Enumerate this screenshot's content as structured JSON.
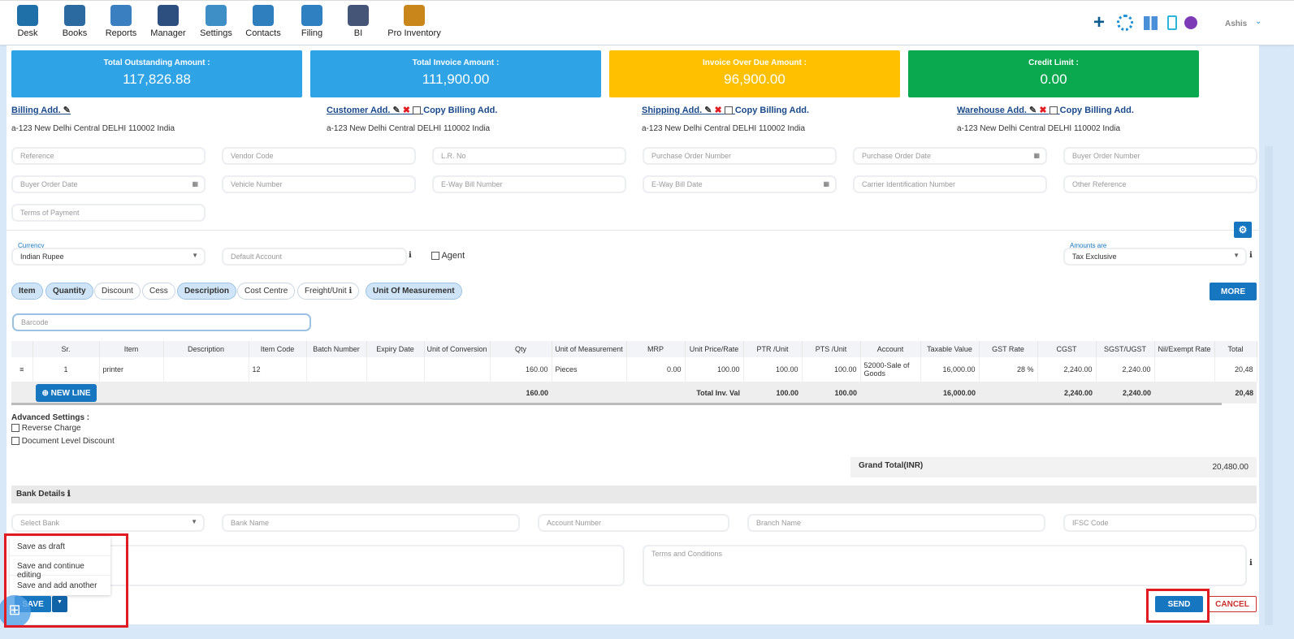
{
  "nav": [
    {
      "label": "Desk",
      "icon": "desk-icon"
    },
    {
      "label": "Books",
      "icon": "books-icon"
    },
    {
      "label": "Reports",
      "icon": "reports-icon"
    },
    {
      "label": "Manager",
      "icon": "manager-icon"
    },
    {
      "label": "Settings",
      "icon": "settings-icon"
    },
    {
      "label": "Contacts",
      "icon": "contacts-icon"
    },
    {
      "label": "Filing",
      "icon": "filing-icon"
    },
    {
      "label": "BI",
      "icon": "bi-icon"
    },
    {
      "label": "Pro Inventory",
      "icon": "pro-inventory-icon"
    }
  ],
  "user": {
    "name": "Ashis"
  },
  "cards": [
    {
      "title": "Total Outstanding Amount :",
      "value": "117,826.88",
      "color": "#2ea3e6"
    },
    {
      "title": "Total Invoice Amount :",
      "value": "111,900.00",
      "color": "#2ea3e6"
    },
    {
      "title": "Invoice Over Due Amount :",
      "value": "96,900.00",
      "color": "#ffc000"
    },
    {
      "title": "Credit Limit :",
      "value": "0.00",
      "color": "#0aa84f"
    }
  ],
  "addresses": [
    {
      "label": "Billing Add.",
      "text": "a-123 New Delhi Central DELHI 110002 India"
    },
    {
      "label": "Customer Add.",
      "copy": "Copy Billing Add.",
      "text": "a-123 New Delhi Central DELHI 110002 India"
    },
    {
      "label": "Shipping Add.",
      "copy": "Copy Billing Add.",
      "text": "a-123 New Delhi Central DELHI 110002 India"
    },
    {
      "label": "Warehouse Add.",
      "copy": "Copy Billing Add.",
      "text": "a-123 New Delhi Central DELHI 110002 India"
    }
  ],
  "fields": [
    "Reference",
    "Vendor Code",
    "L.R. No",
    "Purchase Order Number",
    "Purchase Order Date",
    "Buyer Order Number",
    "Buyer Order Date",
    "Vehicle Number",
    "E-Way Bill Number",
    "E-Way Bill Date",
    "Carrier Identification Number",
    "Other Reference",
    "Terms of Payment"
  ],
  "currency": {
    "label": "Currency",
    "value": "Indian Rupee"
  },
  "default_account": "Default Account",
  "agent": "Agent",
  "amounts": {
    "label": "Amounts are",
    "value": "Tax Exclusive"
  },
  "pills": [
    {
      "label": "Item",
      "on": true
    },
    {
      "label": "Quantity",
      "on": true
    },
    {
      "label": "Discount",
      "on": false
    },
    {
      "label": "Cess",
      "on": false
    },
    {
      "label": "Description",
      "on": true
    },
    {
      "label": "Cost Centre",
      "on": false
    },
    {
      "label": "Freight/Unit",
      "on": false
    },
    {
      "label": "Unit Of Measurement",
      "on": true
    }
  ],
  "more": "MORE",
  "barcode": "Barcode",
  "table": {
    "headers": [
      "",
      "Sr.",
      "Item",
      "Description",
      "Item Code",
      "Batch Number",
      "Expiry Date",
      "Unit of Conversion",
      "Qty",
      "Unit of Measurement",
      "MRP",
      "Unit Price/Rate",
      "PTR /Unit",
      "PTS /Unit",
      "Account",
      "Taxable Value",
      "GST Rate",
      "CGST",
      "SGST/UGST",
      "Nil/Exempt Rate",
      "Total"
    ],
    "rows": [
      [
        "≡",
        "1",
        "printer",
        "",
        "12",
        "",
        "",
        "",
        "160.00",
        "Pieces",
        "0.00",
        "100.00",
        "100.00",
        "100.00",
        "52000-Sale of Goods",
        "16,000.00",
        "28 %",
        "2,240.00",
        "2,240.00",
        "",
        "20,48"
      ]
    ],
    "totals": {
      "qty": "160.00",
      "label": "Total Inv. Val",
      "ptr": "100.00",
      "pts": "100.00",
      "taxable": "16,000.00",
      "cgst": "2,240.00",
      "sgst": "2,240.00",
      "total": "20,48"
    },
    "new_line": "NEW LINE"
  },
  "advanced": {
    "title": "Advanced Settings :",
    "options": [
      "Reverse Charge",
      "Document Level Discount"
    ]
  },
  "grand_total": {
    "label": "Grand Total(INR)",
    "value": "20,480.00"
  },
  "bank": {
    "title": "Bank Details",
    "fields": [
      "Select Bank",
      "Bank Name",
      "Account Number",
      "Branch Name",
      "IFSC Code"
    ]
  },
  "terms": "Terms and Conditions",
  "save_menu": [
    "Save as draft",
    "Save and continue editing",
    "Save and add another"
  ],
  "save": "SAVE",
  "send": "SEND",
  "cancel": "CANCEL"
}
